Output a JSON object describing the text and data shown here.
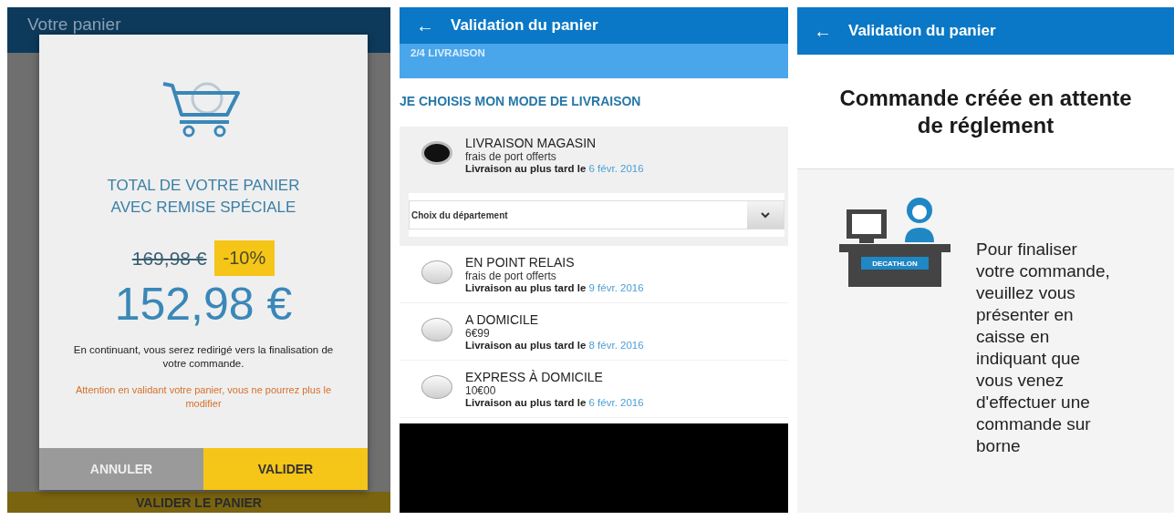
{
  "cart_screen": {
    "title": "Votre panier",
    "bottom_button": "VALIDER LE PANIER",
    "dialog": {
      "title_lines": [
        "TOTAL DE VOTRE PANIER",
        "AVEC REMISE SPÉCIALE"
      ],
      "old_price": "169,98 €",
      "discount": "-10%",
      "new_price": "152,98 €",
      "info": "En continuant, vous serez redirigé vers la finalisation de votre commande.",
      "warning": "Attention en validant votre panier, vous ne pourrez plus le modifier",
      "buttons": [
        {
          "label": "ANNULER",
          "kind": "secondary"
        },
        {
          "label": "VALIDER",
          "kind": "primary"
        }
      ]
    }
  },
  "delivery_screen": {
    "back": "←",
    "title": "Validation du panier",
    "step": "2/4 LIVRAISON",
    "heading": "JE CHOISIS MON MODE DE LIVRAISON",
    "options": [
      {
        "name": "LIVRAISON MAGASIN",
        "price": "frais de port offerts",
        "date_label": "Livraison au plus tard le",
        "date": "6 févr. 2016",
        "selected": true,
        "department_select": {
          "value": "Choix du département"
        }
      },
      {
        "name": "EN POINT RELAIS",
        "price": "frais de port offerts",
        "date_label": "Livraison au plus tard le",
        "date": "9 févr. 2016",
        "selected": false
      },
      {
        "name": "A DOMICILE",
        "price": "6€99",
        "date_label": "Livraison au plus tard le",
        "date": "8 févr. 2016",
        "selected": false
      },
      {
        "name": "EXPRESS À DOMICILE",
        "price": "10€00",
        "date_label": "Livraison au plus tard le",
        "date": "6 févr. 2016",
        "selected": false
      }
    ]
  },
  "confirmation_screen": {
    "back": "←",
    "title": "Validation du panier",
    "heading": "Commande créée en attente de réglement",
    "illustration": {
      "sign": "DECATHLON"
    },
    "message": "Pour finaliser votre commande, veuillez vous présenter en caisse en indiquant que vous venez d'effectuer une commande sur borne"
  }
}
